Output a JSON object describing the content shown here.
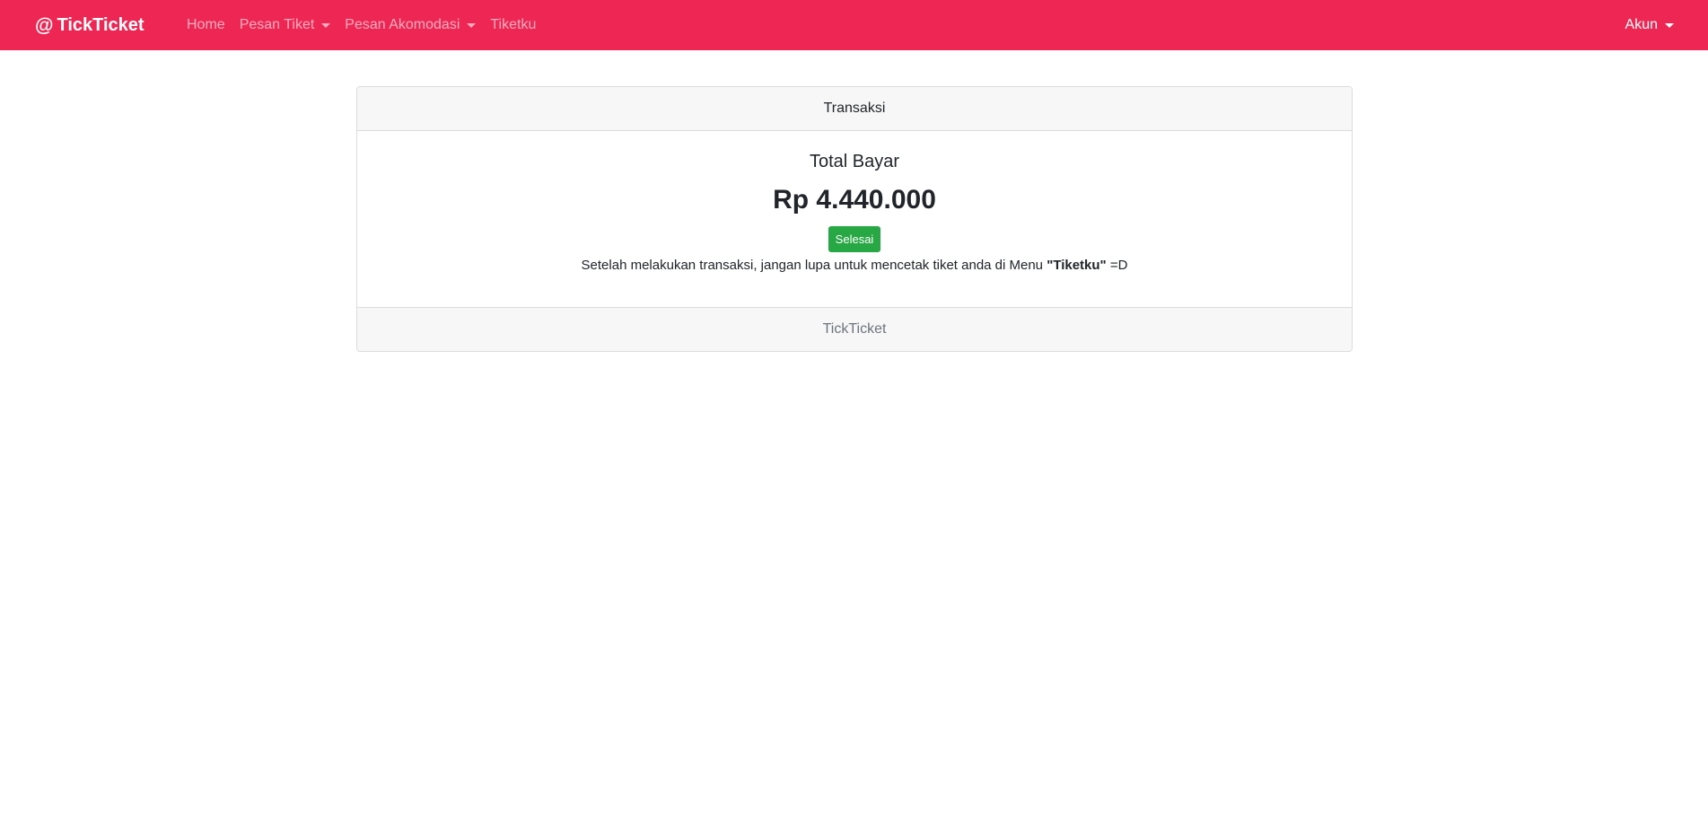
{
  "navbar": {
    "brand": "TickTicket",
    "brand_icon": "at-sign-icon",
    "items": [
      {
        "label": "Home",
        "dropdown": false
      },
      {
        "label": "Pesan Tiket",
        "dropdown": true
      },
      {
        "label": "Pesan Akomodasi",
        "dropdown": true
      },
      {
        "label": "Tiketku",
        "dropdown": false
      }
    ],
    "account_label": "Akun",
    "background_color": "#ee2653"
  },
  "card": {
    "header": "Transaksi",
    "total_label": "Total Bayar",
    "total_amount": "Rp 4.440.000",
    "button_label": "Selesai",
    "button_color": "#28a745",
    "note_prefix": "Setelah melakukan transaksi, jangan lupa untuk mencetak tiket anda di Menu ",
    "note_highlight": "\"Tiketku\"",
    "note_suffix": " =D",
    "footer": "TickTicket"
  }
}
